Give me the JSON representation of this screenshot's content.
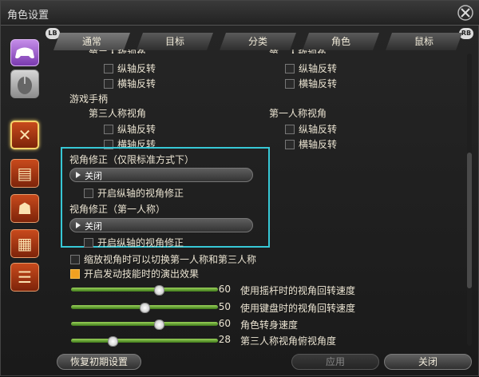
{
  "window": {
    "title": "角色设置"
  },
  "mode_icons": [
    "gamepad-icon",
    "mouse-icon"
  ],
  "category_icons": [
    "camera-cross-icon",
    "card-icon",
    "character-icon",
    "checkered-icon",
    "chat-icon"
  ],
  "tabs": {
    "lb": "LB",
    "rb": "RB",
    "items": [
      "通常",
      "目标",
      "分类",
      "角色",
      "鼠标"
    ]
  },
  "content": {
    "cut_left_header": "第三人称视角",
    "cut_right_header": "第一人称视角",
    "invert_v": "纵轴反转",
    "invert_h": "横轴反转",
    "gamepad_section": "游戏手柄",
    "third_person": "第三人称视角",
    "first_person": "第一人称视角",
    "cam_fix_std": "视角修正（仅限标准方式下）",
    "dropdown_close": "关闭",
    "enable_vert_fix": "开启纵轴的视角修正",
    "cam_fix_fp": "视角修正（第一人称）",
    "zoom_switch": "缩放视角时可以切换第一人称和第三人称",
    "skill_effect": "开启发动技能时的演出效果"
  },
  "sliders": [
    {
      "value": "60",
      "label": "使用摇杆时的视角回转速度",
      "fraction": 0.6
    },
    {
      "value": "50",
      "label": "使用键盘时的视角回转速度",
      "fraction": 0.5
    },
    {
      "value": "60",
      "label": "角色转身速度",
      "fraction": 0.6
    },
    {
      "value": "28",
      "label": "第三人称视角俯视角度",
      "fraction": 0.28
    }
  ],
  "buttons": {
    "reset": "恢复初期设置",
    "apply": "应用",
    "close": "关闭"
  },
  "colors": {
    "highlight": "#37c8d6",
    "checked": "#f0a020",
    "slider": "#6aa83a"
  }
}
